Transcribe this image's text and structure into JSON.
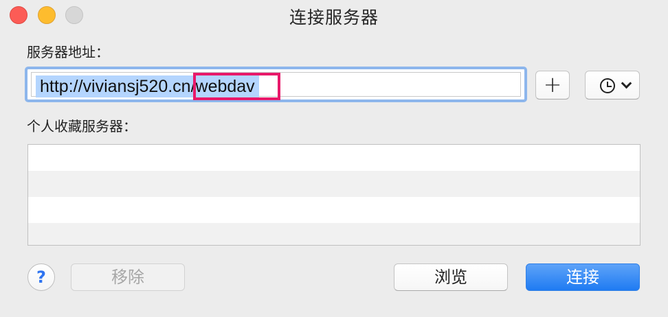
{
  "window": {
    "title": "连接服务器",
    "traffic_lights": [
      "close",
      "minimize",
      "zoom"
    ]
  },
  "server_address": {
    "label": "服务器地址：",
    "value": "http://viviansj520.cn/webdav",
    "highlighted_part": "n/webdav"
  },
  "toolbar": {
    "add_label": "+",
    "history_icon": "clock-icon",
    "history_chevron_icon": "chevron-down-icon"
  },
  "favorites": {
    "label": "个人收藏服务器：",
    "rows": [
      "",
      "",
      "",
      ""
    ]
  },
  "footer": {
    "help_label": "?",
    "remove_label": "移除",
    "browse_label": "浏览",
    "connect_label": "连接"
  },
  "colors": {
    "accent": "#1f7bf2",
    "selection": "#b4d5fe",
    "focus_ring": "#8db6ec",
    "annotation": "#e8196a"
  }
}
